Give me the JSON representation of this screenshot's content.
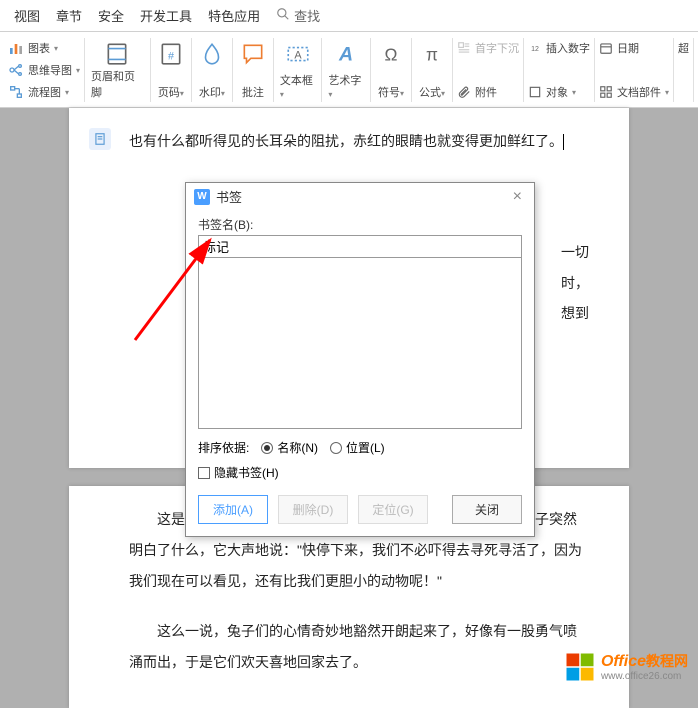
{
  "menu": {
    "items": [
      "视图",
      "章节",
      "安全",
      "开发工具",
      "特色应用"
    ],
    "search": "查找"
  },
  "ribbon": {
    "chart": "图表",
    "mindmap": "思维导图",
    "flowchart": "流程图",
    "header_footer": "页眉和页脚",
    "page_number": "页码",
    "watermark": "水印",
    "comment": "批注",
    "textbox": "文本框",
    "wordart": "艺术字",
    "symbol": "符号",
    "formula": "公式",
    "dropcap": "首字下沉",
    "insert_number": "插入数字",
    "attachment": "附件",
    "object": "对象",
    "docparts": "文档部件",
    "date": "日期",
    "more": "超"
  },
  "doc": {
    "line1": "也有什么都听得见的长耳朵的阻扰，赤红的眼睛也就变得更加鲜红了。",
    "hidden1": "一切",
    "hidden2": "时，",
    "hidden3": "想到",
    "p2_1": "这是兔子每次到池塘边都会看到的情景，但是今天，有一只兔子突然明白了什么，它大声地说：\"快停下来，我们不必吓得去寻死寻活了，因为我们现在可以看见，还有比我们更胆小的动物呢！\"",
    "p2_2": "这么一说，兔子们的心情奇妙地豁然开朗起来了，好像有一股勇气喷涌而出，于是它们欢天喜地回家去了。"
  },
  "dialog": {
    "title": "书签",
    "name_label": "书签名(B):",
    "name_value": "标记",
    "sort_label": "排序依据:",
    "sort_name": "名称(N)",
    "sort_location": "位置(L)",
    "hide_label": "隐藏书签(H)",
    "btn_add": "添加(A)",
    "btn_delete": "删除(D)",
    "btn_goto": "定位(G)",
    "btn_close": "关闭"
  },
  "watermark": {
    "brand": "Office",
    "brand2": "教程网",
    "url": "www.office26.com"
  }
}
